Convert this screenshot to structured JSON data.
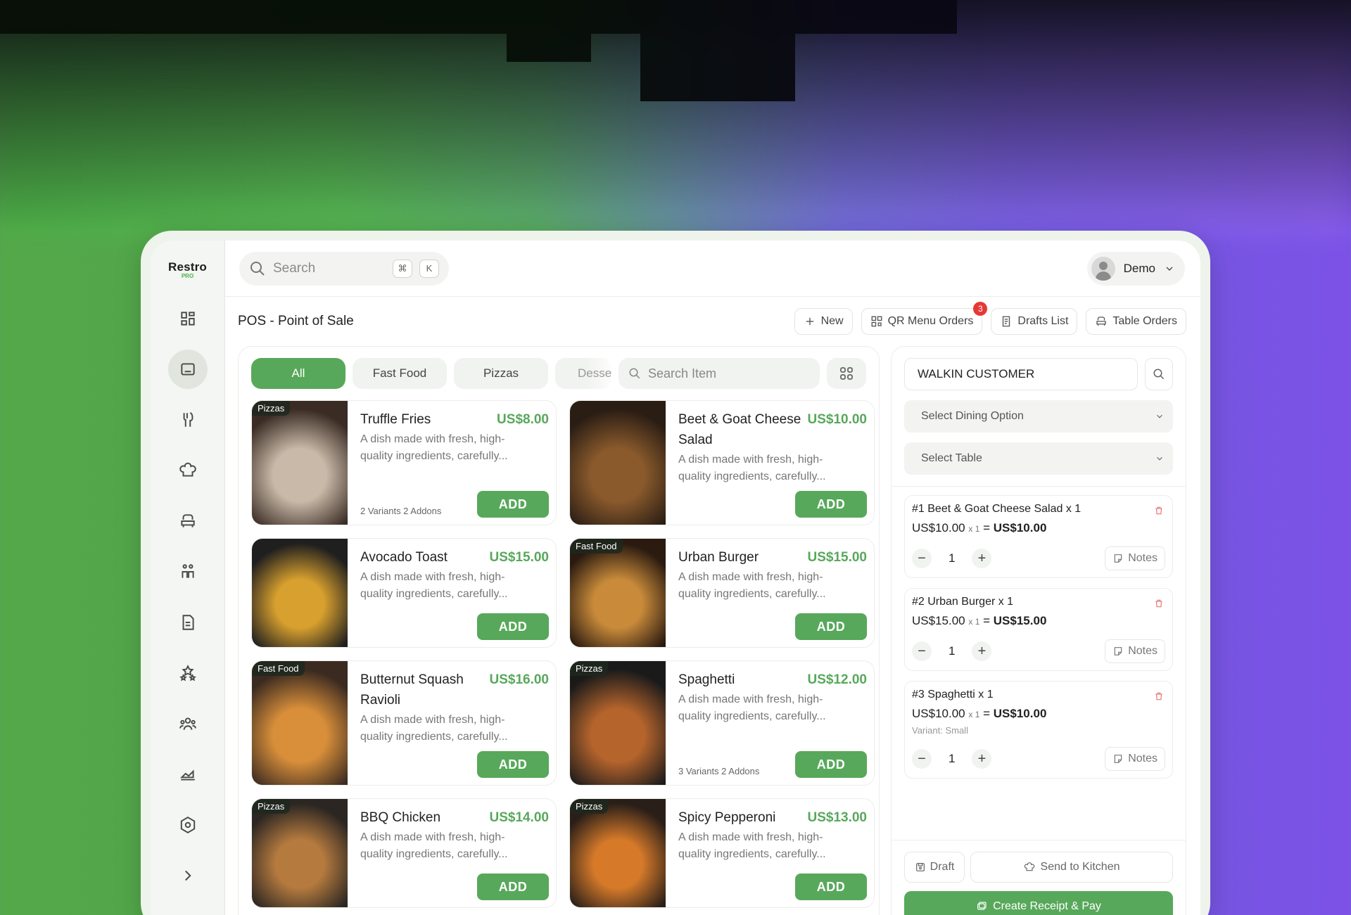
{
  "app": {
    "logo_main": "Restro",
    "logo_sub": "PRO"
  },
  "topbar": {
    "search_placeholder": "Search",
    "shortcut_keys": [
      "⌘",
      "K"
    ],
    "user_name": "Demo"
  },
  "header": {
    "title": "POS - Point of Sale",
    "actions": [
      {
        "label": "New",
        "icon": "plus-icon"
      },
      {
        "label": "QR Menu Orders",
        "icon": "qr-icon",
        "badge": "3"
      },
      {
        "label": "Drafts List",
        "icon": "document-icon"
      },
      {
        "label": "Table Orders",
        "icon": "seat-icon"
      }
    ]
  },
  "sidebar": {
    "items": [
      {
        "name": "dashboard"
      },
      {
        "name": "pos",
        "active": true
      },
      {
        "name": "menu"
      },
      {
        "name": "kitchen"
      },
      {
        "name": "tables"
      },
      {
        "name": "staff"
      },
      {
        "name": "orders"
      },
      {
        "name": "reviews"
      },
      {
        "name": "customers"
      },
      {
        "name": "reports"
      },
      {
        "name": "settings"
      },
      {
        "name": "expand"
      }
    ]
  },
  "filters": {
    "categories": [
      "All",
      "Fast Food",
      "Pizzas",
      "Desse"
    ],
    "active": "All",
    "item_search_placeholder": "Search Item"
  },
  "products": [
    {
      "name": "Truffle Fries",
      "price": "US$8.00",
      "tag": "Pizzas",
      "desc": "A dish made with fresh, high-quality ingredients, carefully...",
      "variants": "2 Variants 2 Addons",
      "add": "ADD",
      "colors": [
        "#3a2b24",
        "#c9b9a8"
      ]
    },
    {
      "name": "Beet & Goat Cheese Salad",
      "price": "US$10.00",
      "tag": "",
      "desc": "A dish made with fresh, high-quality ingredients, carefully...",
      "variants": "",
      "add": "ADD",
      "colors": [
        "#2a1d14",
        "#8a5a2c"
      ]
    },
    {
      "name": "Avocado Toast",
      "price": "US$15.00",
      "tag": "",
      "desc": "A dish made with fresh, high-quality ingredients, carefully...",
      "variants": "",
      "add": "ADD",
      "colors": [
        "#1f1f1f",
        "#d8a02e"
      ]
    },
    {
      "name": "Urban Burger",
      "price": "US$15.00",
      "tag": "Fast Food",
      "desc": "A dish made with fresh, high-quality ingredients, carefully...",
      "variants": "",
      "add": "ADD",
      "colors": [
        "#2a1a10",
        "#c98b3a"
      ]
    },
    {
      "name": "Butternut Squash Ravioli",
      "price": "US$16.00",
      "tag": "Fast Food",
      "desc": "A dish made with fresh, high-quality ingredients, carefully...",
      "variants": "",
      "add": "ADD",
      "colors": [
        "#3a2a20",
        "#d98f3a"
      ]
    },
    {
      "name": "Spaghetti",
      "price": "US$12.00",
      "tag": "Pizzas",
      "desc": "A dish made with fresh, high-quality ingredients, carefully...",
      "variants": "3 Variants 2 Addons",
      "add": "ADD",
      "colors": [
        "#1a1a1a",
        "#b5642c"
      ]
    },
    {
      "name": "BBQ Chicken",
      "price": "US$14.00",
      "tag": "Pizzas",
      "desc": "A dish made with fresh, high-quality ingredients, carefully...",
      "variants": "",
      "add": "ADD",
      "colors": [
        "#2b2622",
        "#b57a3e"
      ]
    },
    {
      "name": "Spicy Pepperoni",
      "price": "US$13.00",
      "tag": "Pizzas",
      "desc": "A dish made with fresh, high-quality ingredients, carefully...",
      "variants": "",
      "add": "ADD",
      "colors": [
        "#2a1f18",
        "#d67a2a"
      ]
    }
  ],
  "order": {
    "customer": "WALKIN CUSTOMER",
    "dining_option": "Select Dining Option",
    "table": "Select Table",
    "lines": [
      {
        "title": "#1 Beet & Goat Cheese Salad x 1",
        "unit": "US$10.00",
        "qx": "x 1",
        "eq": "=",
        "total": "US$10.00",
        "variant": "",
        "qty": "1",
        "notes": "Notes"
      },
      {
        "title": "#2 Urban Burger x 1",
        "unit": "US$15.00",
        "qx": "x 1",
        "eq": "=",
        "total": "US$15.00",
        "variant": "",
        "qty": "1",
        "notes": "Notes"
      },
      {
        "title": "#3 Spaghetti x 1",
        "unit": "US$10.00",
        "qx": "x 1",
        "eq": "=",
        "total": "US$10.00",
        "variant": "Variant: Small",
        "qty": "1",
        "notes": "Notes"
      }
    ],
    "draft_label": "Draft",
    "kitchen_label": "Send to Kitchen",
    "pay_label": "Create Receipt & Pay"
  },
  "colors": {
    "accent": "#58a85b",
    "badge": "#e53935"
  }
}
